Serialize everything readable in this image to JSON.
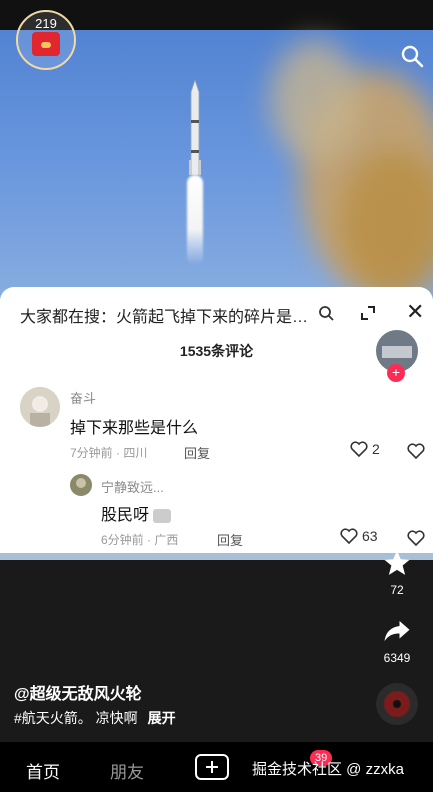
{
  "hongbao": {
    "count": "219"
  },
  "comment_sheet": {
    "search_hint": "大家都在搜：火箭起飞掉下来的碎片是…",
    "count_label": "1535条评论",
    "comments": [
      {
        "nickname": "奋斗",
        "text": "掉下来那些是什么",
        "time": "7分钟前 · 四川",
        "reply": "回复",
        "likes": "2"
      },
      {
        "nickname": "宁静致远...",
        "text": "股民呀",
        "time": "6分钟前 · 广西",
        "reply": "回复",
        "likes": "63"
      }
    ]
  },
  "right_rail": {
    "star_count": "72",
    "share_count": "6349"
  },
  "post": {
    "author": "@超级无敌风火轮",
    "caption": "#航天火箭。  凉快啊",
    "expand": "展开"
  },
  "tabbar": {
    "home": "首页",
    "friends": "朋友",
    "badge": "39",
    "watermark": "掘金技术社区 @ zzxka"
  }
}
